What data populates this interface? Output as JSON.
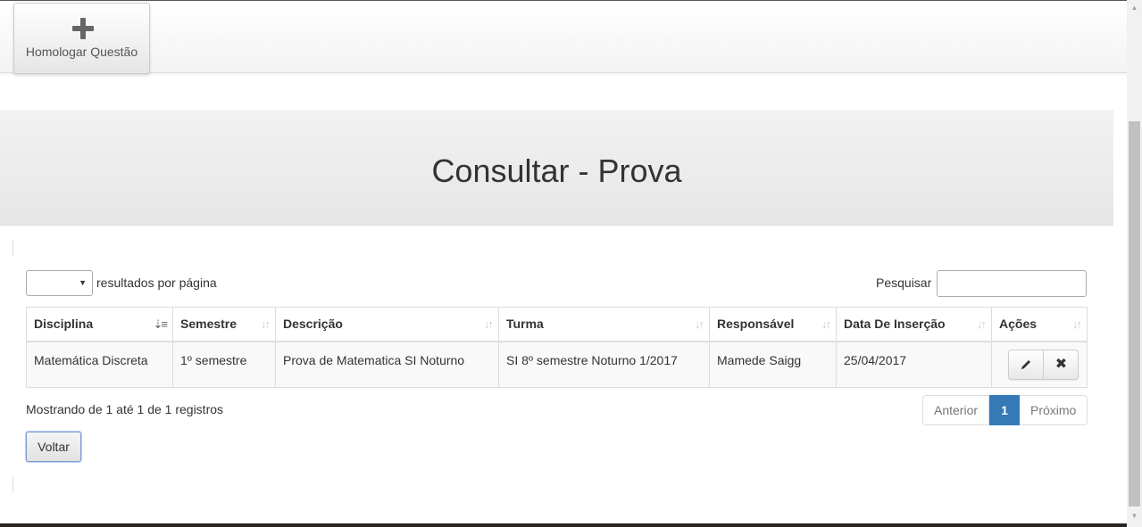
{
  "navbar": {
    "homologar_label": "Homologar Questão",
    "homologar_icon": "plus-icon"
  },
  "header": {
    "title": "Consultar - Prova"
  },
  "table_controls": {
    "length_selected": "",
    "length_suffix": "resultados por página",
    "search_label": "Pesquisar",
    "search_value": ""
  },
  "table": {
    "columns": [
      "Disciplina",
      "Semestre",
      "Descrição",
      "Turma",
      "Responsável",
      "Data De Inserção",
      "Ações"
    ],
    "sorted_column": "Disciplina",
    "sorted_direction": "ascending",
    "rows": [
      {
        "disciplina": "Matemática Discreta",
        "semestre": "1º semestre",
        "descricao": "Prova de Matematica SI Noturno",
        "turma": "SI 8º semestre Noturno 1/2017",
        "responsavel": "Mamede Saigg",
        "data": "25/04/2017",
        "actions": [
          "pencil-icon",
          "close-icon"
        ]
      }
    ]
  },
  "footer": {
    "info": "Mostrando de 1 até 1 de 1 registros",
    "pagination": {
      "previous": "Anterior",
      "current": "1",
      "next": "Próximo"
    },
    "back_label": "Voltar"
  },
  "colors": {
    "accent": "#337ab7",
    "jumbotron": "#ebebeb",
    "border": "#dddddd"
  }
}
